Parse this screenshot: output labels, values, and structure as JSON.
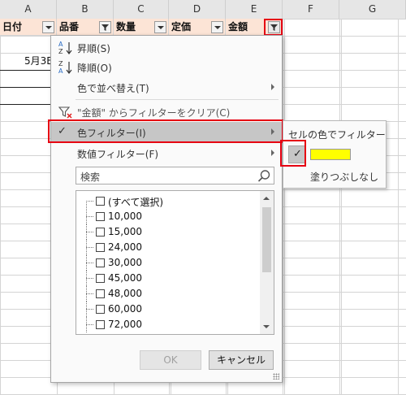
{
  "sheet": {
    "columns": [
      "A",
      "B",
      "C",
      "D",
      "E",
      "F",
      "G"
    ],
    "headers": [
      {
        "label": "日付"
      },
      {
        "label": "品番"
      },
      {
        "label": "数量"
      },
      {
        "label": "定価"
      },
      {
        "label": "金額"
      }
    ],
    "cell_a3": "5月3E",
    "header_fill": "#fce4d6"
  },
  "menu": {
    "sort_asc": "昇順(S)",
    "sort_desc": "降順(O)",
    "sort_by_color": "色で並べ替え(T)",
    "clear_filter": "\"金額\" からフィルターをクリア(C)",
    "color_filter": "色フィルター(I)",
    "number_filter": "数値フィルター(F)"
  },
  "search": {
    "placeholder": "検索"
  },
  "list": {
    "items": [
      "(すべて選択)",
      "10,000",
      "15,000",
      "24,000",
      "30,000",
      "45,000",
      "48,000",
      "60,000",
      "72,000"
    ]
  },
  "buttons": {
    "ok": "OK",
    "cancel": "キャンセル"
  },
  "submenu": {
    "title": "セルの色でフィルター",
    "swatch_color": "#ffff00",
    "no_fill": "塗りつぶしなし"
  },
  "colors": {
    "highlight_border": "#e60012",
    "menu_highlight": "#c6c6c6"
  }
}
